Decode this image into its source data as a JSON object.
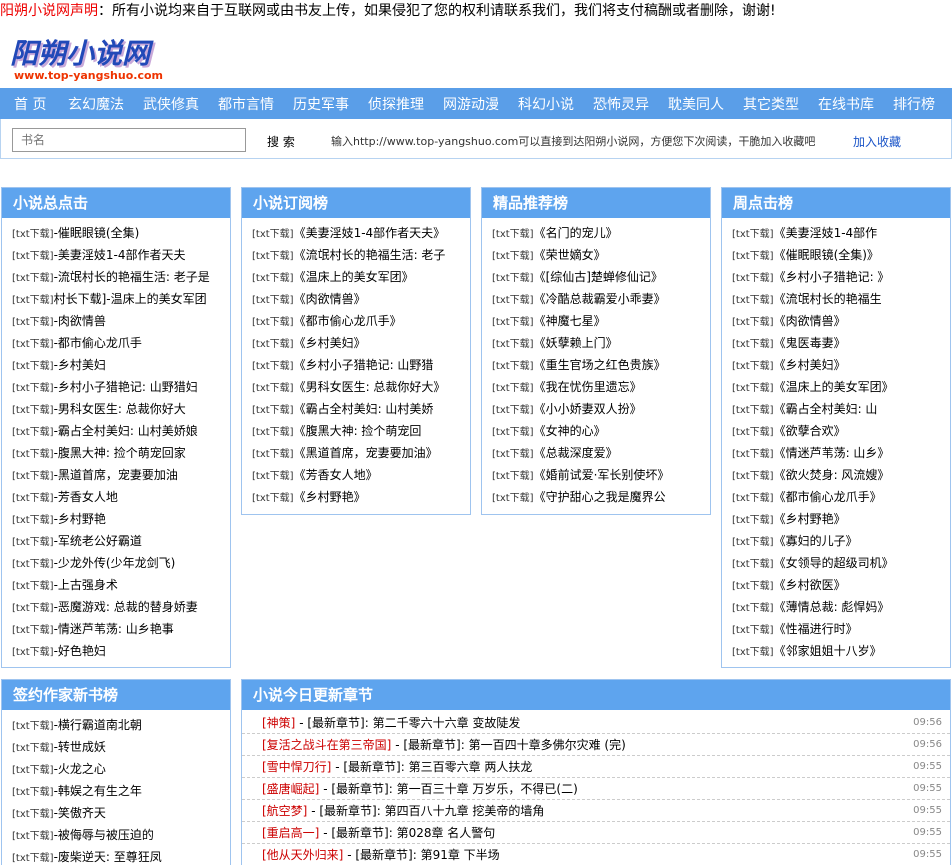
{
  "notice": {
    "highlight": "阳朔小说网声明",
    "text": "：所有小说均来自于互联网或由书友上传，如果侵犯了您的权利请联系我们，我们将支付稿酬或者删除，谢谢!"
  },
  "logo": {
    "title": "阳朔小说网",
    "url": "www.top-yangshuo.com"
  },
  "nav": [
    "首 页",
    "玄幻魔法",
    "武侠修真",
    "都市言情",
    "历史军事",
    "侦探推理",
    "网游动漫",
    "科幻小说",
    "恐怖灵异",
    "耽美同人",
    "其它类型",
    "在线书库",
    "排行榜"
  ],
  "search": {
    "placeholder": "书名",
    "button": "搜 索",
    "tip": "输入http://www.top-yangshuo.com可以直接到达阳朔小说网，方便您下次阅读，干脆加入收藏吧",
    "fav": "加入收藏"
  },
  "tag": "[txt下载]",
  "box_total": {
    "title": "小说总点击",
    "items": [
      "-催眠眼镜(全集)",
      "-美妻淫妓1-4部作者天夫",
      "-流氓村长的艳福生活: 老子是",
      "村长下载]-温床上的美女军团",
      "-肉欲情兽",
      "-都市偷心龙爪手",
      "-乡村美妇",
      "-乡村小子猎艳记: 山野猎妇",
      "-男科女医生: 总裁你好大",
      "-霸占全村美妇: 山村美娇娘",
      "-腹黑大神: 捡个萌宠回家",
      "-黑道首席，宠妻要加油",
      "-芳香女人地",
      "-乡村野艳",
      "-军统老公好霸道",
      "-少龙外传(少年龙剑飞)",
      "-上古强身术",
      "-恶魔游戏: 总裁的替身娇妻",
      "-情迷芦苇荡: 山乡艳事",
      "-好色艳妇"
    ]
  },
  "box_sub": {
    "title": "小说订阅榜",
    "items": [
      "《美妻淫妓1-4部作者天夫》",
      "《流氓村长的艳福生活: 老子",
      "《温床上的美女军团》",
      "《肉欲情兽》",
      "《都市偷心龙爪手》",
      "《乡村美妇》",
      "《乡村小子猎艳记: 山野猎",
      "《男科女医生: 总裁你好大》",
      "《霸占全村美妇: 山村美娇",
      "《腹黑大神: 捡个萌宠回",
      "《黑道首席，宠妻要加油》",
      "《芳香女人地》",
      "《乡村野艳》"
    ]
  },
  "box_rec": {
    "title": "精品推荐榜",
    "items": [
      "《名门的宠儿》",
      "《荣世嫡女》",
      "《[综仙古]楚蝉修仙记》",
      "《冷酷总裁霸爱小乖妻》",
      "《神魔七星》",
      "《妖孽赖上门》",
      "《重生官场之红色贵族》",
      "《我在忧伤里遗忘》",
      "《小小娇妻双人扮》",
      "《女神的心》",
      "《总裁深度爱》",
      "《婚前试爱·军长别使坏》",
      "《守护甜心之我是魔界公"
    ]
  },
  "box_week": {
    "title": "周点击榜",
    "items": [
      "《美妻淫妓1-4部作",
      "《催眠眼镜(全集)》",
      "《乡村小子猎艳记: 》",
      "《流氓村长的艳福生",
      "《肉欲情兽》",
      "《鬼医毒妻》",
      "《乡村美妇》",
      "《温床上的美女军团》",
      "《霸占全村美妇: 山",
      "《欲孽合欢》",
      "《情迷芦苇荡: 山乡》",
      "《欲火焚身: 风流嫂》",
      "《都市偷心龙爪手》",
      "《乡村野艳》",
      "《寡妇的儿子》",
      "《女领导的超级司机》",
      "《乡村欲医》",
      "《薄情总裁: 彪悍妈》",
      "《性福进行时》",
      "《邻家姐姐十八岁》"
    ]
  },
  "box_new": {
    "title": "签约作家新书榜",
    "items": [
      "-横行霸道南北朝",
      "-转世成妖",
      "-火龙之心",
      "-韩娱之有生之年",
      "-笑傲齐天",
      "-被侮辱与被压迫的",
      "-废柴逆天: 至尊狂凤"
    ]
  },
  "box_upd": {
    "title": "小说今日更新章节",
    "items": [
      {
        "book": "[神策]",
        "chap": "第二千零六十六章 变故陡发",
        "time": "09:56"
      },
      {
        "book": "[复活之战斗在第三帝国]",
        "chap": "第一百四十章多佛尔灾难 (完)",
        "time": "09:56"
      },
      {
        "book": "[雪中悍刀行]",
        "chap": "第三百零六章 两人扶龙",
        "time": "09:55"
      },
      {
        "book": "[盛唐崛起]",
        "chap": "第一百三十章 万岁乐，不得已(二)",
        "time": "09:55"
      },
      {
        "book": "[航空梦]",
        "chap": "第四百八十九章 挖美帝的墙角",
        "time": "09:55"
      },
      {
        "book": "[重启高一]",
        "chap": "第028章 名人警句",
        "time": "09:55"
      },
      {
        "book": "[他从天外归来]",
        "chap": "第91章 下半场",
        "time": "09:55"
      }
    ],
    "sep": " - ",
    "label": "[最新章节]: "
  }
}
